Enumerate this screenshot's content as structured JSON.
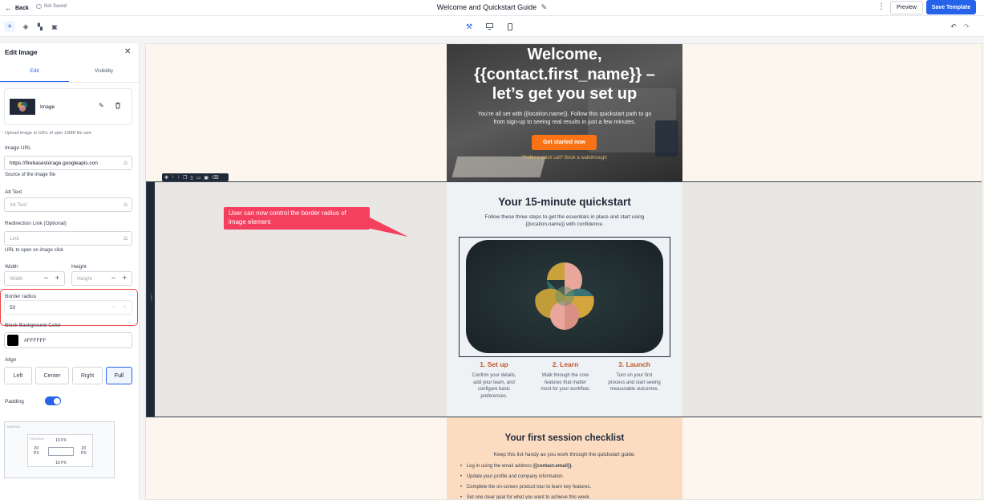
{
  "header": {
    "back_label": "Back",
    "save_status": "Not Saved",
    "title": "Welcome and Quickstart Guide",
    "preview_label": "Preview",
    "save_label": "Save Template"
  },
  "panel": {
    "title": "Edit Image",
    "tabs": [
      {
        "label": "Edit"
      },
      {
        "label": "Visibility"
      }
    ],
    "image_name": "Image",
    "upload_hint": "Upload image or GIFs of upto 10MB file size",
    "image_url": {
      "label": "Image URL",
      "value": "https://firebasestorage.googleapis.con",
      "hint": "Source of the image file"
    },
    "alt_text": {
      "label": "Alt Text",
      "placeholder": "Alt Text"
    },
    "redirect": {
      "label": "Redirection Link (Optional)",
      "placeholder": "Link",
      "hint": "URL to open on image click"
    },
    "width": {
      "label": "Width",
      "placeholder": "Width"
    },
    "height": {
      "label": "Height",
      "placeholder": "Height"
    },
    "border_radius": {
      "label": "Border radius",
      "value": "50"
    },
    "bg_color": {
      "label": "Block Background Color",
      "value": "#FFFFFF",
      "swatch": "#000000"
    },
    "align": {
      "label": "Align",
      "options": [
        "Left",
        "Center",
        "Right",
        "Full"
      ],
      "selected": "Full"
    },
    "padding": {
      "label": "Padding",
      "enabled": true
    },
    "box": {
      "margin_label": "MARGIN",
      "padding_label": "PADDING",
      "top": "10 PX",
      "bottom": "10 PX",
      "left": "20\nPX",
      "right": "20\nPX",
      "left_num": "20",
      "left_unit": "PX",
      "right_num": "20",
      "right_unit": "PX"
    }
  },
  "hero": {
    "heading_1": "Welcome,",
    "heading_2": "{{contact.first_name}} –",
    "heading_3": "let’s get you set up",
    "sub_1": "You’re all set with {{location.name}}. Follow this quickstart path to go",
    "sub_2": "from sign-up to seeing real results in just a few minutes.",
    "cta": "Get started now",
    "link": "Prefer a quick call? Book a walkthrough"
  },
  "annotation": "User can now control the border radius of image element",
  "quickstart": {
    "title": "Your 15-minute quickstart",
    "sub_1": "Follow these three steps to get the essentials in place and start using",
    "sub_2": "{{location.name}} with confidence.",
    "steps": [
      {
        "title": "1. Set up",
        "l1": "Confirm your details,",
        "l2": "add your team, and",
        "l3": "configure basic",
        "l4": "preferences."
      },
      {
        "title": "2. Learn",
        "l1": "Walk through the core",
        "l2": "features that matter",
        "l3": "most for your workflow.",
        "l4": ""
      },
      {
        "title": "3. Launch",
        "l1": "Turn on your first",
        "l2": "process and start seeing",
        "l3": "measurable outcomes.",
        "l4": ""
      }
    ]
  },
  "checklist": {
    "title": "Your first session checklist",
    "sub": "Keep this list handy as you work through the quickstart guide.",
    "items": [
      {
        "pre": "Log in using the email address ",
        "bold": "{{contact.email}}",
        "post": "."
      },
      {
        "pre": "Update your profile and company information.",
        "bold": "",
        "post": ""
      },
      {
        "pre": "Complete the on-screen product tour to learn key features.",
        "bold": "",
        "post": ""
      },
      {
        "pre": "Set one clear goal for what you want to achieve this week.",
        "bold": "",
        "post": ""
      }
    ]
  },
  "colors": {
    "accent": "#2563eb",
    "cta": "#f97316",
    "highlight": "#ef4444",
    "step": "#c0562b"
  }
}
